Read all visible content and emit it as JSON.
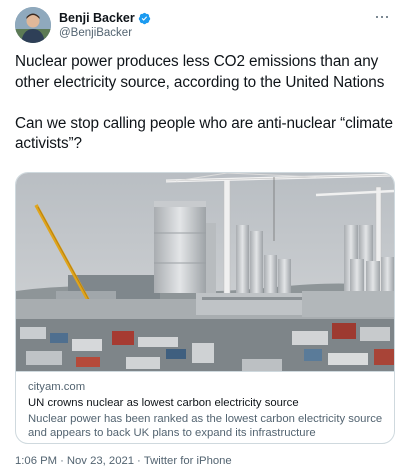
{
  "author": {
    "display_name": "Benji Backer",
    "handle": "@BenjiBacker",
    "verified": true
  },
  "tweet": {
    "text": "Nuclear power produces less CO2 emissions than any other electricity source, according to the United Nations\n\nCan we stop calling people who are anti-nuclear “climate activists”?"
  },
  "card": {
    "domain": "cityam.com",
    "title": "UN crowns nuclear as lowest carbon electricity source",
    "description": "Nuclear power has been ranked as the lowest carbon electricity source and appears to back UK plans to expand its infrastructure"
  },
  "meta": {
    "time": "1:06 PM",
    "separator": "·",
    "date": "Nov 23, 2021",
    "source": "Twitter for iPhone"
  },
  "colors": {
    "text_primary": "#0f1419",
    "text_secondary": "#536471",
    "verified_blue": "#1d9bf0",
    "border": "#cfd9de"
  },
  "icons": {
    "verified": "verified-badge-icon",
    "more": "more-options-icon"
  }
}
